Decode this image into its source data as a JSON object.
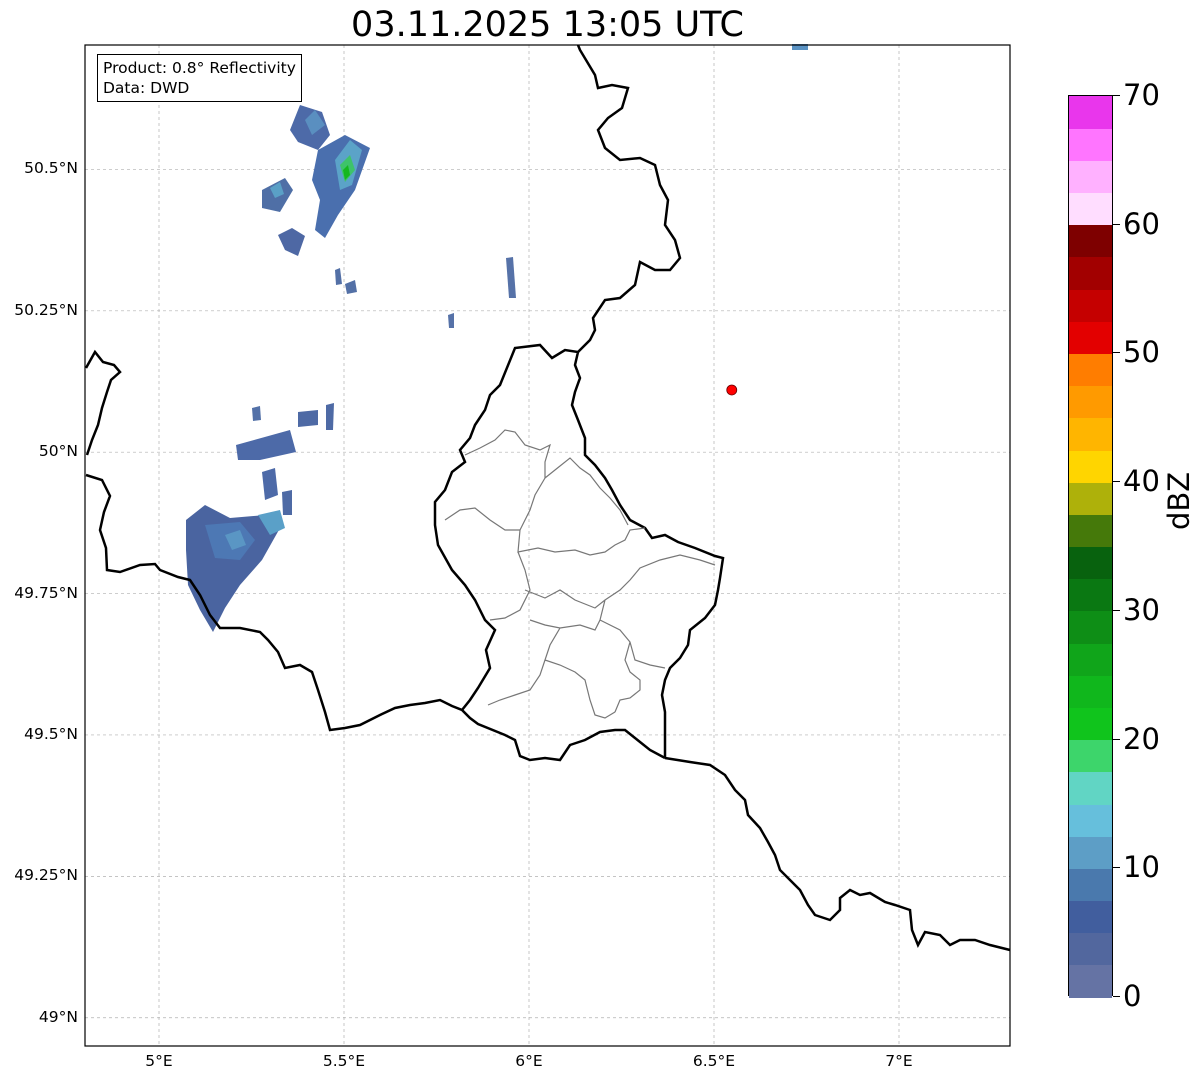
{
  "title": "03.11.2025 13:05 UTC",
  "info_box": {
    "product": "Product: 0.8° Reflectivity",
    "data_source": "Data: DWD"
  },
  "map": {
    "lon_range": [
      4.8,
      7.3
    ],
    "lat_range": [
      48.95,
      50.72
    ],
    "grid": true,
    "lat_ticks": [
      {
        "value": 50.5,
        "label": "50.5°N"
      },
      {
        "value": 50.25,
        "label": "50.25°N"
      },
      {
        "value": 50.0,
        "label": "50°N"
      },
      {
        "value": 49.75,
        "label": "49.75°N"
      },
      {
        "value": 49.5,
        "label": "49.5°N"
      },
      {
        "value": 49.25,
        "label": "49.25°N"
      },
      {
        "value": 49.0,
        "label": "49°N"
      }
    ],
    "lon_ticks": [
      {
        "value": 5.0,
        "label": "5°E"
      },
      {
        "value": 5.5,
        "label": "5.5°E"
      },
      {
        "value": 6.0,
        "label": "6°E"
      },
      {
        "value": 6.5,
        "label": "6.5°E"
      },
      {
        "value": 7.0,
        "label": "7°E"
      }
    ],
    "radar_site_marker": {
      "lon": 6.548,
      "lat": 50.11,
      "color": "#ff0000"
    },
    "echo_patches": [
      {
        "lon": 5.38,
        "lat": 50.55,
        "dbz": 8
      },
      {
        "lon": 5.42,
        "lat": 50.53,
        "dbz": 10
      },
      {
        "lon": 5.5,
        "lat": 50.48,
        "dbz": 22
      },
      {
        "lon": 5.47,
        "lat": 50.44,
        "dbz": 12
      },
      {
        "lon": 5.33,
        "lat": 50.43,
        "dbz": 9
      },
      {
        "lon": 5.36,
        "lat": 50.36,
        "dbz": 7
      },
      {
        "lon": 5.95,
        "lat": 50.3,
        "dbz": 6
      },
      {
        "lon": 5.28,
        "lat": 49.99,
        "dbz": 7
      },
      {
        "lon": 5.4,
        "lat": 50.03,
        "dbz": 6
      },
      {
        "lon": 5.12,
        "lat": 49.83,
        "dbz": 8
      },
      {
        "lon": 5.2,
        "lat": 49.8,
        "dbz": 10
      },
      {
        "lon": 5.3,
        "lat": 49.87,
        "dbz": 9
      },
      {
        "lon": 5.12,
        "lat": 49.73,
        "dbz": 7
      },
      {
        "lon": 6.74,
        "lat": 50.71,
        "dbz": 12
      }
    ]
  },
  "colorbar": {
    "unit": "dBZ",
    "min": 0,
    "max": 70,
    "tick_labels": [
      "0",
      "10",
      "20",
      "30",
      "40",
      "50",
      "60",
      "70"
    ],
    "colors": [
      "#6573a4",
      "#52679e",
      "#415e9e",
      "#4a79ad",
      "#5d9ec6",
      "#66bfdc",
      "#61d5c4",
      "#3dd56b",
      "#10c41c",
      "#10b71c",
      "#10a51a",
      "#0e8e16",
      "#0a7812",
      "#08620e",
      "#45790a",
      "#aeb10a",
      "#ffd500",
      "#ffb500",
      "#ff9a00",
      "#ff7d00",
      "#e30000",
      "#c50000",
      "#a20000",
      "#7e0000",
      "#ffddff",
      "#ffb1ff",
      "#ff75ff",
      "#e936ec"
    ]
  }
}
